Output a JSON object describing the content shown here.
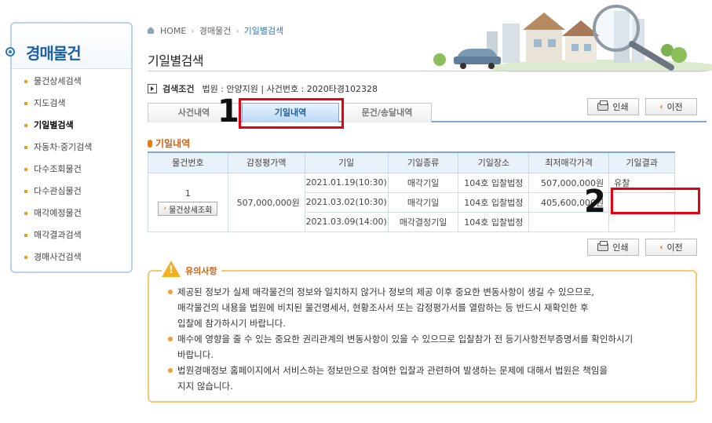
{
  "sidebar": {
    "title": "경매물건",
    "items": [
      {
        "label": "물건상세검색",
        "active": false
      },
      {
        "label": "지도검색",
        "active": false
      },
      {
        "label": "기일별검색",
        "active": true
      },
      {
        "label": "자동차·중기검색",
        "active": false
      },
      {
        "label": "다수조회물건",
        "active": false
      },
      {
        "label": "다수관심물건",
        "active": false
      },
      {
        "label": "매각예정물건",
        "active": false
      },
      {
        "label": "매각결과검색",
        "active": false
      },
      {
        "label": "경매사건검색",
        "active": false
      }
    ]
  },
  "breadcrumb": {
    "home": "HOME",
    "level1": "경매물건",
    "current": "기일별검색"
  },
  "page_title": "기일별검색",
  "search_condition": {
    "label": "검색조건",
    "text": "법원 : 안양지원 | 사건번호 : 2020타경102328"
  },
  "tabs": [
    {
      "label": "사건내역",
      "active": false
    },
    {
      "label": "기일내역",
      "active": true
    },
    {
      "label": "문건/송달내역",
      "active": false
    }
  ],
  "buttons": {
    "print": "인쇄",
    "prev": "이전"
  },
  "section_title": "기일내역",
  "table": {
    "headers": [
      "물건번호",
      "감정평가액",
      "기일",
      "기일종류",
      "기일장소",
      "최저매각가격",
      "기일결과"
    ],
    "item_no": "1",
    "detail_button": "물건상세조회",
    "appraisal": "507,000,000원",
    "rows": [
      {
        "date": "2021.01.19(10:30)",
        "type": "매각기일",
        "place": "104호 입찰법정",
        "min_price": "507,000,000원",
        "result": "유찰"
      },
      {
        "date": "2021.03.02(10:30)",
        "type": "매각기일",
        "place": "104호 입찰법정",
        "min_price": "405,600,000원",
        "result": ""
      },
      {
        "date": "2021.03.09(14:00)",
        "type": "매각결정기일",
        "place": "104호 입찰법정",
        "min_price": "",
        "result": ""
      }
    ]
  },
  "annotations": {
    "one": "1",
    "two": "2"
  },
  "notice": {
    "title": "유의사항",
    "items": [
      "제공된 정보가 실제 매각물건의 정보와 일치하지 않거나 정보의 제공 이후 중요한 변동사항이 생길 수 있으므로,\n매각물건의 내용을 법원에 비치된 물건명세서, 현황조사서 또는 감정평가서를 열람하는 등 반드시 재확인한 후\n입찰에 참가하시기 바랍니다.",
      "매수에 영향을 줄 수 있는 중요한 권리관계의 변동사항이 있을 수 있으므로 입찰참가 전 등기사항전부증명서를 확인하시기\n바랍니다.",
      "법원경매정보 홈페이지에서 서비스하는 정보만으로 참여한 입찰과 관련하여 발생하는 문제에 대해서 법원은 책임을\n지지 않습니다."
    ]
  },
  "colors": {
    "accent_blue": "#1a5fa8",
    "accent_orange": "#d9600a",
    "annotation_red": "#e60012"
  }
}
